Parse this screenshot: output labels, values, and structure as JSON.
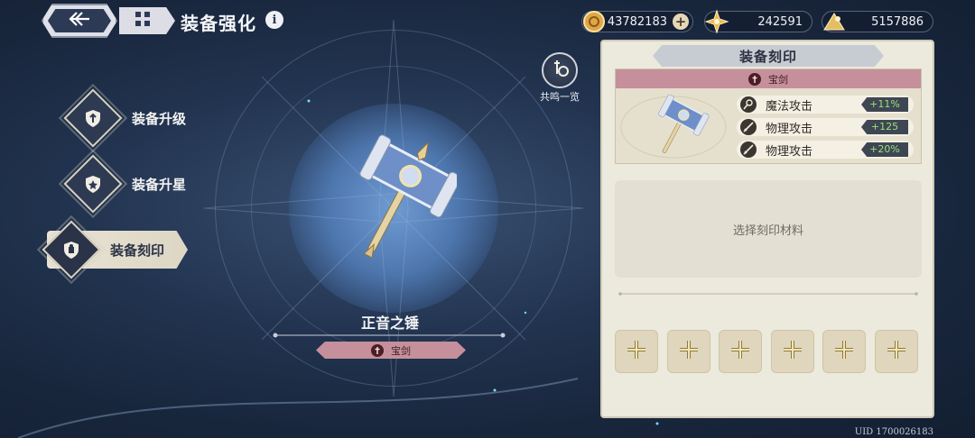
{
  "header": {
    "title": "装备强化",
    "info_glyph": "i"
  },
  "currencies": [
    {
      "name": "gold-coin",
      "value": "43782183",
      "plus": "+"
    },
    {
      "name": "star-crystal",
      "value": "242591"
    },
    {
      "name": "gold-pile",
      "value": "5157886"
    }
  ],
  "menu": {
    "items": [
      {
        "label": "装备升级",
        "icon": "shield-upgrade-icon"
      },
      {
        "label": "装备升星",
        "icon": "shield-star-icon"
      },
      {
        "label": "装备刻印",
        "icon": "shield-engrave-icon",
        "active": true
      }
    ]
  },
  "item": {
    "name": "正音之锤",
    "tag": "宝剑"
  },
  "resonance": {
    "label": "共鸣一览"
  },
  "panel": {
    "title": "装备刻印",
    "card": {
      "tag": "宝剑",
      "stats": [
        {
          "name": "魔法攻击",
          "value": "+11%",
          "icon": "magic-wand-icon"
        },
        {
          "name": "物理攻击",
          "value": "+125",
          "icon": "sword-icon"
        },
        {
          "name": "物理攻击",
          "value": "+20%",
          "icon": "sword-icon"
        }
      ]
    },
    "select_text": "选择刻印材料",
    "slots_count_label": "6"
  },
  "footer": {
    "uid": "UID 1700026183"
  },
  "colors": {
    "accent_pink": "#c58f9c",
    "panel_bg": "#eceadd",
    "stat_green": "#9be07a",
    "bg_dark": "#18263c"
  }
}
